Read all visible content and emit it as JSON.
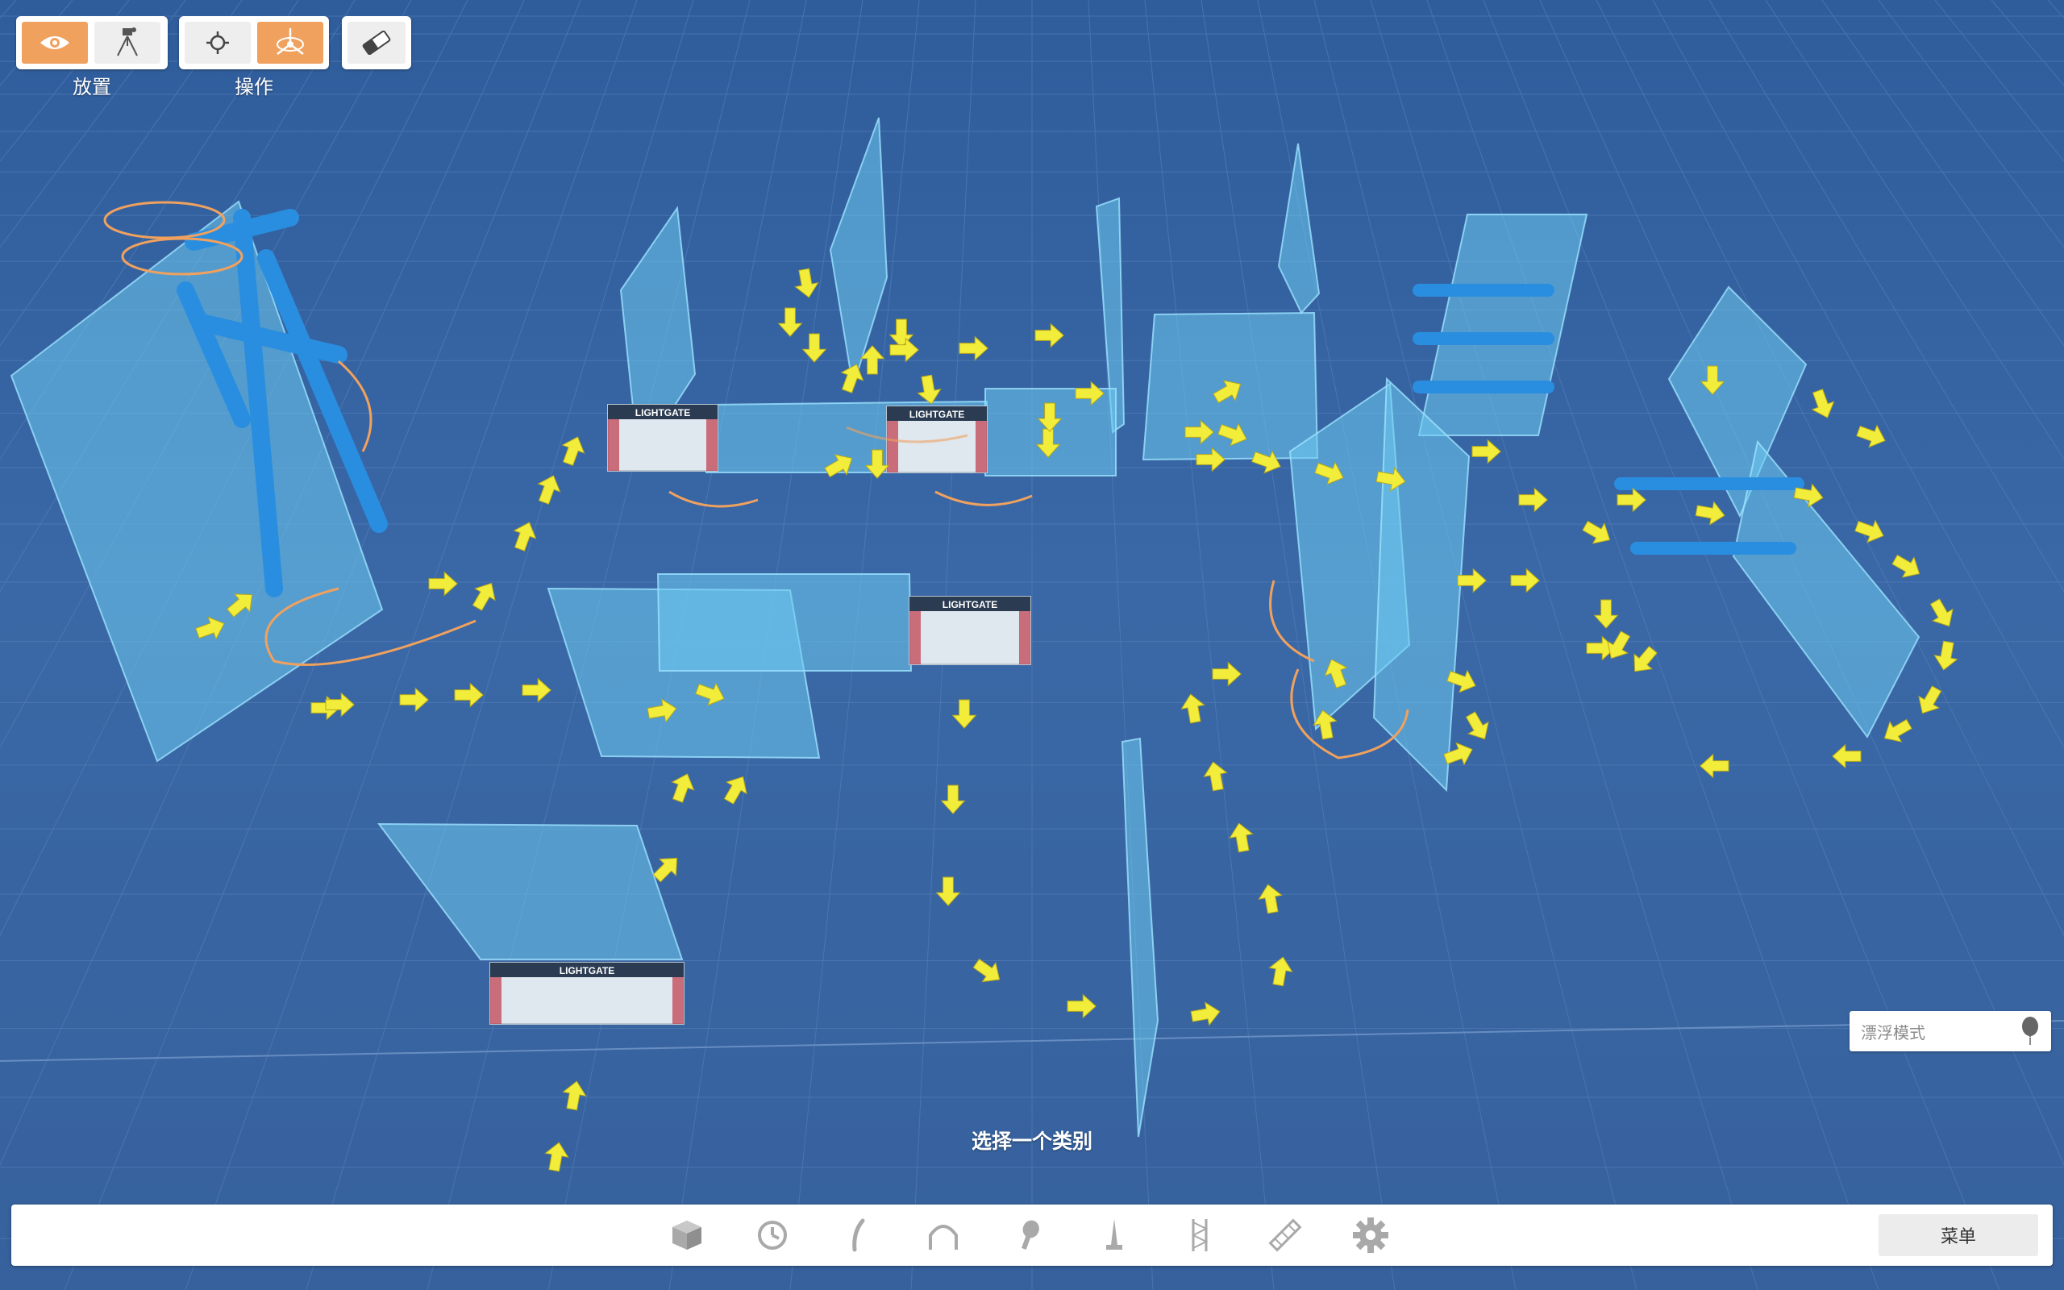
{
  "toolbar": {
    "groups": [
      {
        "label": "放置",
        "buttons": [
          {
            "icon": "eye-icon",
            "active": true
          },
          {
            "icon": "camera-tripod-icon",
            "active": false
          }
        ]
      },
      {
        "label": "操作",
        "buttons": [
          {
            "icon": "crosshair-icon",
            "active": false
          },
          {
            "icon": "move-gizmo-icon",
            "active": true
          }
        ]
      },
      {
        "label": "",
        "buttons": [
          {
            "icon": "eraser-icon",
            "active": false
          }
        ]
      }
    ]
  },
  "scene": {
    "gate_brand": "LIGHTGATE"
  },
  "float_mode": {
    "label": "漂浮模式",
    "icon": "balloon-icon"
  },
  "bottom": {
    "hint": "选择一个类别",
    "menu_label": "菜单",
    "categories": [
      {
        "name": "cube-icon"
      },
      {
        "name": "timer-icon"
      },
      {
        "name": "pole-icon"
      },
      {
        "name": "arch-icon"
      },
      {
        "name": "marker-icon"
      },
      {
        "name": "flag-icon"
      },
      {
        "name": "truss-icon"
      },
      {
        "name": "ramp-icon"
      },
      {
        "name": "gear-icon"
      }
    ]
  },
  "colors": {
    "accent": "#f0a15e",
    "panel": "#6ecbf0",
    "ground": "#3a68a6",
    "arrow": "#f2ec3a"
  }
}
